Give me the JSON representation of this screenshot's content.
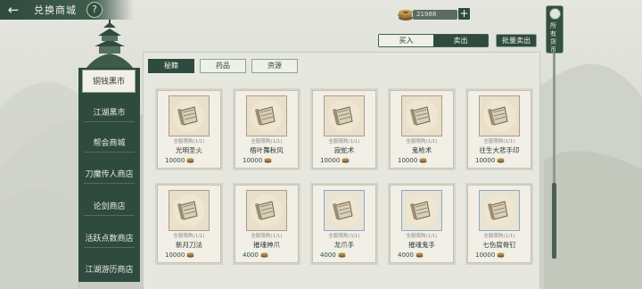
{
  "header": {
    "title": "兑换商城",
    "back_icon": "back-arrow-icon",
    "help_label": "?"
  },
  "currency": {
    "amount": "21988",
    "plus_label": "+"
  },
  "ribbon": {
    "label": "所有货币"
  },
  "trade_tabs": [
    {
      "label": "买入",
      "active": false
    },
    {
      "label": "卖出",
      "active": true
    }
  ],
  "bulk_sell_label": "批量卖出",
  "sidebar": {
    "items": [
      {
        "label": "铜钱黑市",
        "active": true
      },
      {
        "label": "江湖黑市",
        "active": false
      },
      {
        "label": "帮会商城",
        "active": false
      },
      {
        "label": "刀魔传人商店",
        "active": false
      },
      {
        "label": "论剑商店",
        "active": false
      },
      {
        "label": "活跃点数商店",
        "active": false
      },
      {
        "label": "江湖游历商店",
        "active": false
      }
    ]
  },
  "category_tabs": [
    {
      "label": "秘籍",
      "active": true
    },
    {
      "label": "药品",
      "active": false
    },
    {
      "label": "资源",
      "active": false
    }
  ],
  "items": [
    {
      "name": "光明圣火",
      "limit": "全服限购(1/1)",
      "price": "10000",
      "frame": "gold"
    },
    {
      "name": "梧叶舞秋风",
      "limit": "全服限购(1/1)",
      "price": "10000",
      "frame": "gold"
    },
    {
      "name": "寂蛇术",
      "limit": "全服限购(1/1)",
      "price": "10000",
      "frame": "gold"
    },
    {
      "name": "鬼枪术",
      "limit": "全服限购(1/1)",
      "price": "10000",
      "frame": "gold"
    },
    {
      "name": "往生大悲手印",
      "limit": "全服限购(1/1)",
      "price": "10000",
      "frame": "gold"
    },
    {
      "name": "新月刀法",
      "limit": "全服限购(1/1)",
      "price": "10000",
      "frame": "gold"
    },
    {
      "name": "摧魂神爪",
      "limit": "全服限购(1/1)",
      "price": "4000",
      "frame": "gold"
    },
    {
      "name": "龙爪手",
      "limit": "全服限购(3/1)",
      "price": "4000",
      "frame": "blue"
    },
    {
      "name": "摧魂鬼手",
      "limit": "全服限购(1/1)",
      "price": "4000",
      "frame": "blue"
    },
    {
      "name": "七伤腐骨钉",
      "limit": "全服限购(1/1)",
      "price": "10000",
      "frame": "blue"
    }
  ],
  "colors": {
    "accent_dark": "#2f4a3e",
    "panel": "#e6e8e0",
    "card": "#f1efe6"
  }
}
